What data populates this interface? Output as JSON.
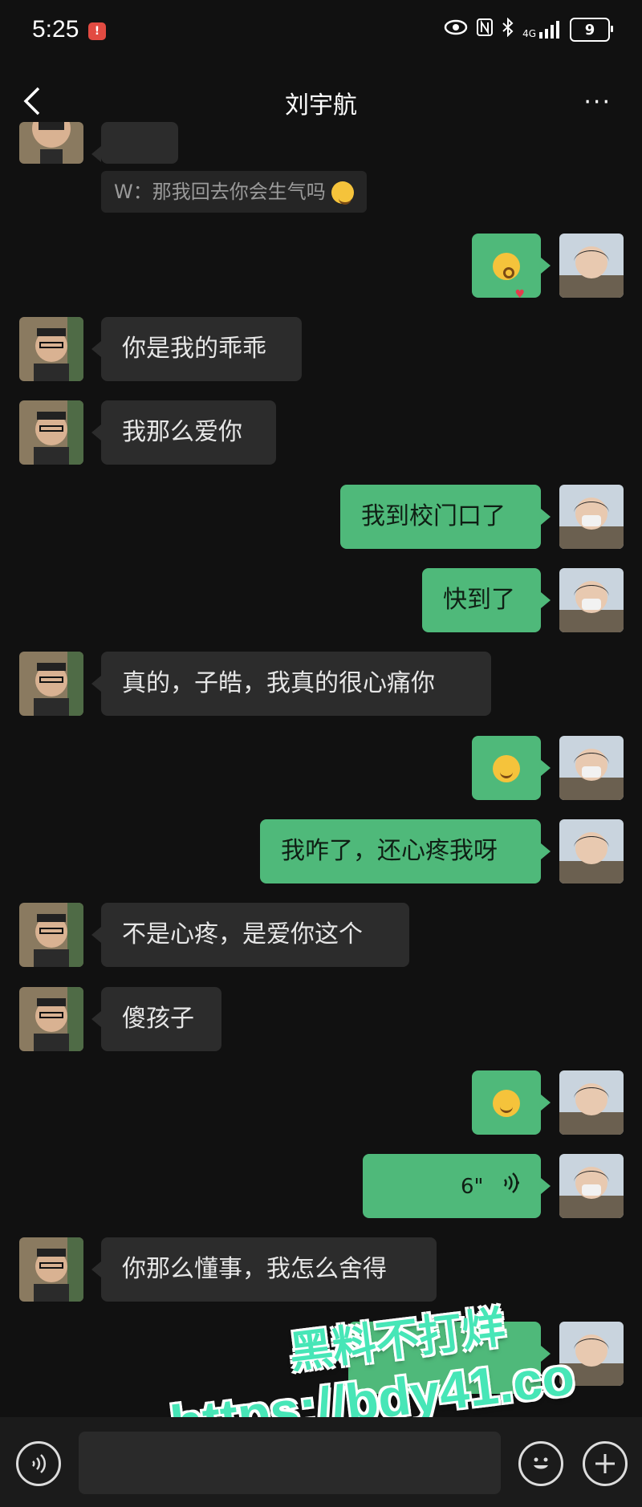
{
  "status": {
    "time": "5:25",
    "alert_badge": "!",
    "icons": [
      "eye-icon",
      "nfc-icon",
      "bluetooth-icon",
      "signal-icon"
    ],
    "network": "4G",
    "battery": "9"
  },
  "header": {
    "title": "刘宇航",
    "more": "···"
  },
  "quote_text": "W：那我回去你会生气吗",
  "messages": [
    {
      "side": "right",
      "kind": "emoji",
      "emoji": "kiss-face-icon"
    },
    {
      "side": "left",
      "text": "你是我的乖乖"
    },
    {
      "side": "left",
      "text": "我那么爱你"
    },
    {
      "side": "right",
      "text": "我到校门口了"
    },
    {
      "side": "right",
      "text": "快到了"
    },
    {
      "side": "left",
      "text": "真的，子皓，我真的很心痛你"
    },
    {
      "side": "right",
      "kind": "emoji",
      "emoji": "smiling-face-icon"
    },
    {
      "side": "right",
      "text": "我咋了，还心疼我呀"
    },
    {
      "side": "left",
      "text": "不是心疼，是爱你这个"
    },
    {
      "side": "left",
      "text": "傻孩子"
    },
    {
      "side": "right",
      "kind": "emoji",
      "emoji": "smiling-face-icon"
    },
    {
      "side": "right",
      "kind": "voice",
      "duration": "6\""
    },
    {
      "side": "left",
      "text": "你那么懂事，我怎么舍得"
    }
  ],
  "watermark": {
    "line1": "黑料不打烊",
    "line2": "https://bdy41.co"
  },
  "colors": {
    "background": "#111111",
    "bubble_left": "#2c2c2c",
    "bubble_right": "#4fb97a",
    "watermark": "#47e6b7"
  }
}
